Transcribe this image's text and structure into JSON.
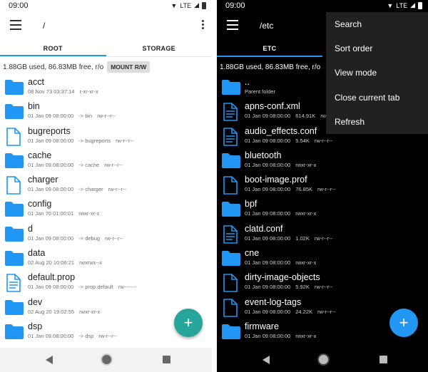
{
  "left": {
    "status_time": "09:00",
    "status_network": "LTE",
    "path": "/",
    "tabs": [
      {
        "label": "ROOT",
        "active": true
      },
      {
        "label": "STORAGE",
        "active": false
      }
    ],
    "storage_text": "1.88GB used, 86.83MB free, r/o",
    "mount_label": "MOUNT R/W",
    "files": [
      {
        "name": "acct",
        "date": "08 Nov 73 03:37:14",
        "extra": "",
        "perms": "r-xr-xr-x",
        "icon": "folder-icon"
      },
      {
        "name": "bin",
        "date": "01 Jan 09 08:00:00",
        "extra": "-> bin",
        "perms": "rw-r--r--",
        "icon": "folder-icon"
      },
      {
        "name": "bugreports",
        "date": "01 Jan 09 08:00:00",
        "extra": "-> bugreports",
        "perms": "rw-r--r--",
        "icon": "file-icon"
      },
      {
        "name": "cache",
        "date": "01 Jan 09 08:00:00",
        "extra": "-> cache",
        "perms": "rw-r--r--",
        "icon": "folder-icon"
      },
      {
        "name": "charger",
        "date": "01 Jan 09 08:00:00",
        "extra": "-> charger",
        "perms": "rw-r--r--",
        "icon": "file-icon"
      },
      {
        "name": "config",
        "date": "01 Jan 70 01:00:01",
        "extra": "",
        "perms": "rwxr-xr-x",
        "icon": "folder-icon"
      },
      {
        "name": "d",
        "date": "01 Jan 09 08:00:00",
        "extra": "-> debug",
        "perms": "rw-r--r--",
        "icon": "folder-icon"
      },
      {
        "name": "data",
        "date": "02 Aug 20 10:06:21",
        "extra": "",
        "perms": "rwxrwx--x",
        "icon": "folder-icon"
      },
      {
        "name": "default.prop",
        "date": "01 Jan 09 08:00:00",
        "extra": "-> prop.default",
        "perms": "rw-------",
        "icon": "text-file-icon"
      },
      {
        "name": "dev",
        "date": "02 Aug 20 19:02:55",
        "extra": "",
        "perms": "rwxr-xr-x",
        "icon": "folder-icon"
      },
      {
        "name": "dsp",
        "date": "01 Jan 09 08:00:00",
        "extra": "-> dsp",
        "perms": "rw-r--r--",
        "icon": "folder-icon"
      }
    ],
    "fab_label": "+"
  },
  "right": {
    "status_time": "09:00",
    "status_network": "LTE",
    "path": "/etc",
    "tabs": [
      {
        "label": "ETC",
        "active": true
      },
      {
        "label": "",
        "active": false
      }
    ],
    "storage_text": "1.88GB used, 86.83MB free, r/o",
    "files": [
      {
        "name": "..",
        "date": "Parent folder",
        "extra": "",
        "perms": "",
        "icon": "folder-icon"
      },
      {
        "name": "apns-conf.xml",
        "date": "01 Jan 09 08:00:00",
        "extra": "614.91K",
        "perms": "rw-r--r--",
        "icon": "text-file-icon"
      },
      {
        "name": "audio_effects.conf",
        "date": "01 Jan 09 08:00:00",
        "extra": "5.54K",
        "perms": "rw-r--r--",
        "icon": "text-file-icon"
      },
      {
        "name": "bluetooth",
        "date": "01 Jan 09 08:00:00",
        "extra": "",
        "perms": "rwxr-xr-x",
        "icon": "folder-icon"
      },
      {
        "name": "boot-image.prof",
        "date": "01 Jan 09 08:00:00",
        "extra": "76.85K",
        "perms": "rw-r--r--",
        "icon": "file-icon"
      },
      {
        "name": "bpf",
        "date": "01 Jan 09 08:00:00",
        "extra": "",
        "perms": "rwxr-xr-x",
        "icon": "folder-icon"
      },
      {
        "name": "clatd.conf",
        "date": "01 Jan 09 08:00:00",
        "extra": "1.02K",
        "perms": "rw-r--r--",
        "icon": "text-file-icon"
      },
      {
        "name": "cne",
        "date": "01 Jan 09 08:00:00",
        "extra": "",
        "perms": "rwxr-xr-x",
        "icon": "folder-icon"
      },
      {
        "name": "dirty-image-objects",
        "date": "01 Jan 09 08:00:00",
        "extra": "5.92K",
        "perms": "rw-r--r--",
        "icon": "file-icon"
      },
      {
        "name": "event-log-tags",
        "date": "01 Jan 09 08:00:00",
        "extra": "24.22K",
        "perms": "rw-r--r--",
        "icon": "file-icon"
      },
      {
        "name": "firmware",
        "date": "01 Jan 09 08:00:00",
        "extra": "",
        "perms": "rwxr-xr-x",
        "icon": "folder-icon"
      }
    ],
    "menu_items": [
      "Search",
      "Sort order",
      "View mode",
      "Close current tab",
      "Refresh"
    ],
    "fab_label": "+"
  },
  "colors": {
    "accent_blue": "#2196f3",
    "fab_teal": "#26a69a"
  }
}
